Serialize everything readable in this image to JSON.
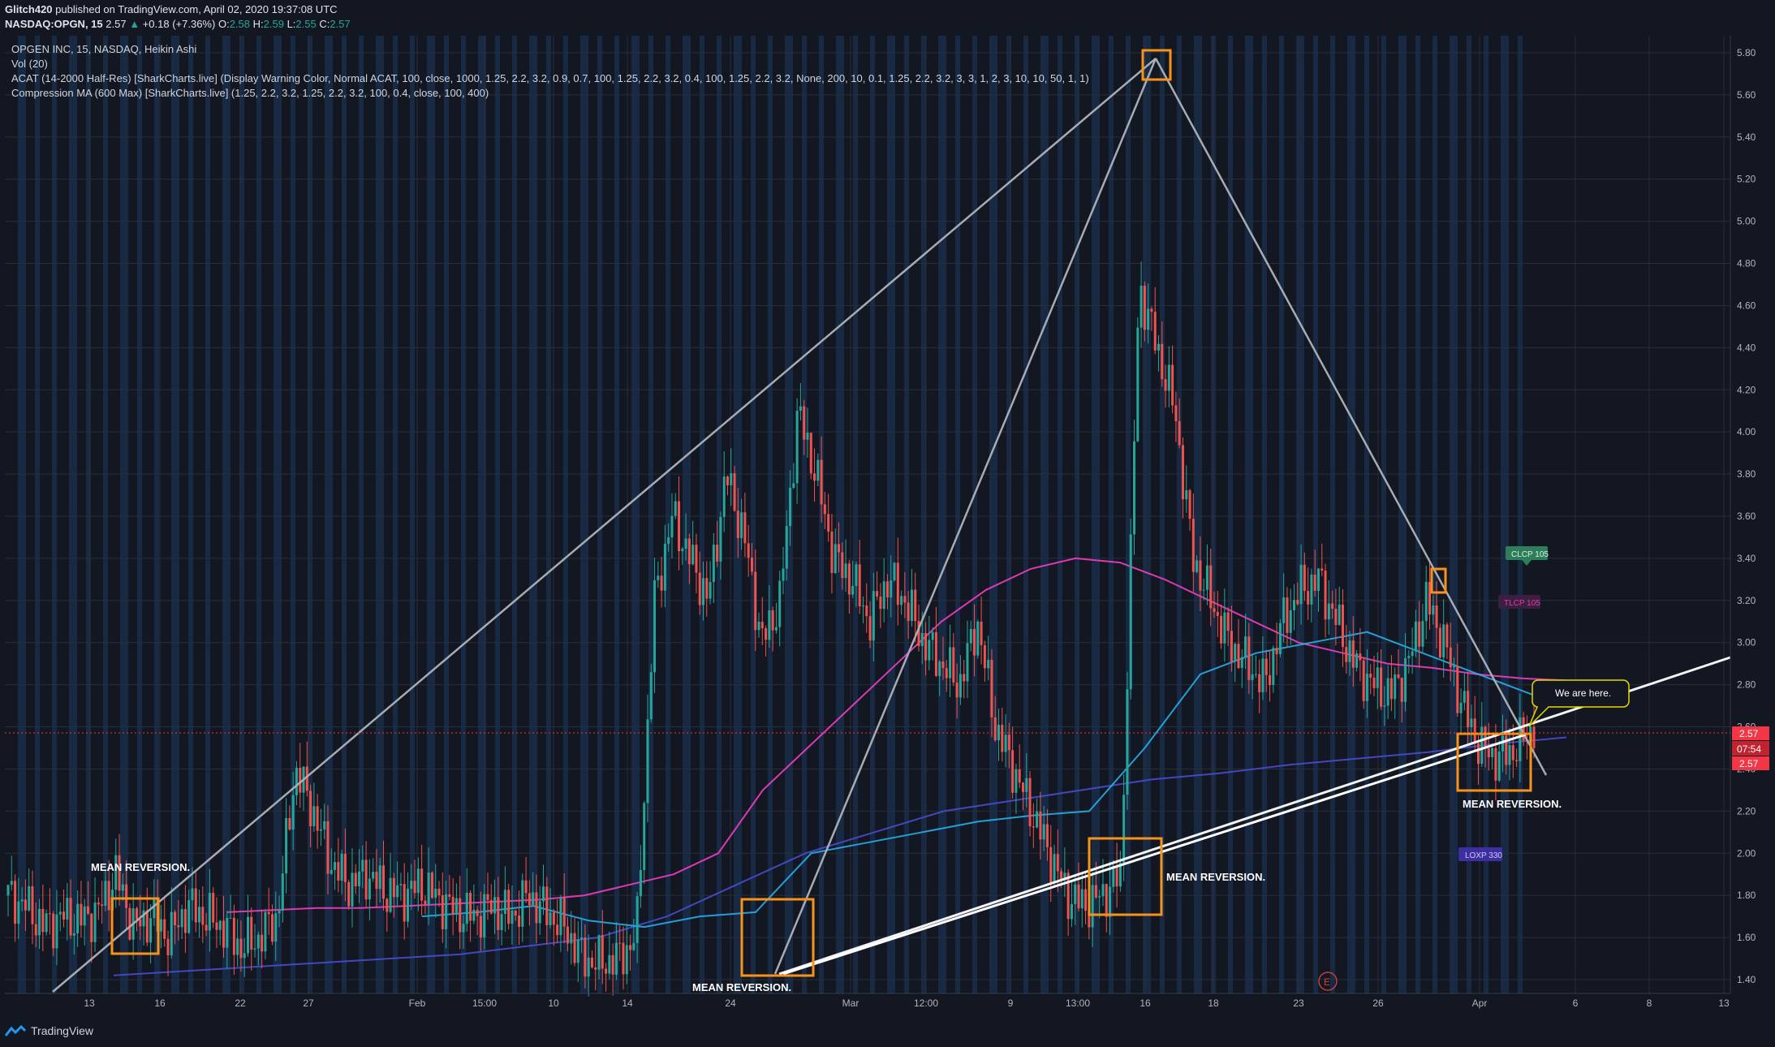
{
  "header": {
    "publisher": "Glitch420",
    "published_text": "published on TradingView.com, April 02, 2020 19:37:08 UTC",
    "symbol": "NASDAQ:OPGN, 15",
    "last": "2.57",
    "change": "+0.18 (+7.36%)",
    "o_label": "O:",
    "o": "2.58",
    "h_label": "H:",
    "h": "2.59",
    "l_label": "L:",
    "l": "2.55",
    "c_label": "C:",
    "c": "2.57"
  },
  "legend": {
    "line1": "OPGEN INC, 15, NASDAQ, Heikin Ashi",
    "line2": "Vol (20)",
    "line3": "ACAT (14-2000 Half-Res) [SharkCharts.live] (Display Warning Color, Normal ACAT, 100, close, 1000, 1.25, 2.2, 3.2, 0.9, 0.7, 100, 1.25, 2.2, 3.2, 0.4, 100, 1.25, 2.2, 3.2, None, 200, 10, 0.1, 1.25, 2.2, 3.2, 3, 3, 1, 2, 3, 10, 10, 50, 1, 1)",
    "line4": "Compression MA (600 Max) [SharkCharts.live] (1.25, 2.2, 3.2, 1.25, 2.2, 3.2, 100, 0.4, close, 100, 400)"
  },
  "footer": {
    "brand": "TradingView"
  },
  "colors": {
    "background": "#131722",
    "up": "#26a69a",
    "down": "#ef5350",
    "price_tag": "#f23645",
    "box": "#f7931a",
    "shade": "#1e3a5f"
  },
  "annotations": {
    "mean_rev_1": "MEAN REVERSION.",
    "mean_rev_2": "MEAN REVERSION.",
    "mean_rev_3": "MEAN REVERSION.",
    "mean_rev_4": "MEAN REVERSION.",
    "we_are_here": "We are here.",
    "clcp": "CLCP 105",
    "tlcp": "TLCP 105",
    "loxp": "LOXP 330",
    "earnings": "E"
  },
  "price_tags": {
    "last": "2.57",
    "countdown": "07:54",
    "prev": "2.57"
  },
  "chart_data": {
    "type": "line",
    "chart_style": "Heikin Ashi candles",
    "y_axis": {
      "position": "right",
      "ticks": [
        "5.80",
        "5.60",
        "5.40",
        "5.20",
        "5.00",
        "4.80",
        "4.60",
        "4.40",
        "4.20",
        "4.00",
        "3.80",
        "3.60",
        "3.40",
        "3.20",
        "3.00",
        "2.80",
        "2.60",
        "2.40",
        "2.20",
        "2.00",
        "1.80",
        "1.60",
        "1.40"
      ],
      "ylim": [
        1.35,
        5.85
      ]
    },
    "x_axis": {
      "ticks": [
        "13",
        "16",
        "22",
        "27",
        "Feb",
        "15:00",
        "10",
        "14",
        "24",
        "Mar",
        "12:00",
        "9",
        "13:00",
        "16",
        "18",
        "23",
        "26",
        "Apr",
        "6",
        "8",
        "13"
      ]
    },
    "grid": true,
    "last_price": 2.57,
    "series": [
      {
        "values": [
          1.8,
          1.75,
          1.65,
          1.7,
          1.68,
          1.72,
          1.9,
          1.65,
          1.7,
          1.6,
          1.75,
          1.7,
          1.65,
          1.55,
          1.6,
          1.7,
          2.4,
          2.2,
          1.95,
          1.85,
          1.9,
          1.82,
          1.8,
          1.85,
          1.78,
          1.72,
          1.7,
          1.75,
          1.7,
          1.8,
          1.72,
          1.65,
          1.5,
          1.48,
          1.5,
          1.6,
          3.2,
          3.6,
          3.4,
          3.2,
          3.8,
          3.5,
          3.0,
          3.2,
          4.1,
          3.8,
          3.4,
          3.3,
          3.1,
          3.3,
          3.2,
          3.0,
          2.9,
          2.8,
          3.1,
          2.6,
          2.4,
          2.2,
          2.0,
          1.8,
          1.75,
          1.8,
          1.9,
          4.7,
          4.4,
          4.1,
          3.4,
          3.2,
          3.0,
          2.9,
          2.8,
          3.1,
          3.25,
          3.3,
          3.1,
          2.9,
          2.8,
          2.75,
          2.9,
          3.2,
          3.0,
          2.7,
          2.5,
          2.45,
          2.5,
          2.6
        ]
      },
      {
        "values": [
          1.72,
          1.73,
          1.74,
          1.74,
          1.75,
          1.76,
          1.77,
          1.78,
          1.8,
          1.85,
          1.9,
          2.0,
          2.3,
          2.5,
          2.7,
          2.9,
          3.1,
          3.25,
          3.35,
          3.4,
          3.38,
          3.3,
          3.2,
          3.1,
          3.0,
          2.95,
          2.9,
          2.88,
          2.85,
          2.83,
          2.82
        ]
      },
      {
        "values": [
          1.42,
          1.44,
          1.46,
          1.48,
          1.5,
          1.52,
          1.56,
          1.6,
          1.7,
          1.85,
          2.0,
          2.1,
          2.2,
          2.25,
          2.3,
          2.35,
          2.38,
          2.42,
          2.45,
          2.48,
          2.52,
          2.55
        ]
      },
      {
        "values": [
          1.7,
          1.72,
          1.75,
          1.68,
          1.65,
          1.7,
          1.72,
          2.0,
          2.05,
          2.1,
          2.15,
          2.18,
          2.2,
          2.5,
          2.85,
          2.95,
          3.0,
          3.05,
          2.95,
          2.85,
          2.75
        ]
      }
    ],
    "trendlines": [
      {
        "from": [
          "13",
          1.38
        ],
        "to": [
          "16",
          5.77
        ]
      },
      {
        "from": [
          "24",
          1.42
        ],
        "to": [
          "16",
          5.77
        ]
      },
      {
        "from": [
          "16",
          5.77
        ],
        "to": [
          "Apr",
          2.4
        ]
      },
      {
        "from": [
          "24",
          1.42
        ],
        "to": [
          "13",
          2.92
        ]
      }
    ]
  }
}
